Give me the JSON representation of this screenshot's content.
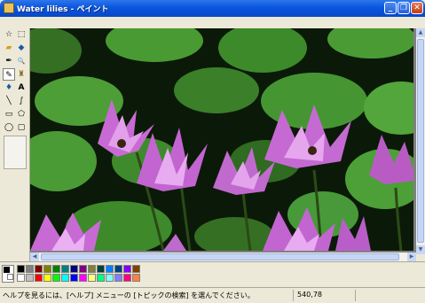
{
  "window": {
    "title": "Water lilies - ペイント",
    "minimize_glyph": "_",
    "maximize_glyph": "❐",
    "close_glyph": "✕"
  },
  "toolbox": {
    "tools": [
      {
        "name": "free-form-select-icon",
        "glyph": "☆"
      },
      {
        "name": "rect-select-icon",
        "glyph": "⬚"
      },
      {
        "name": "eraser-icon",
        "glyph": "▰"
      },
      {
        "name": "fill-bucket-icon",
        "glyph": "◆"
      },
      {
        "name": "color-picker-icon",
        "glyph": "✒"
      },
      {
        "name": "magnifier-icon",
        "glyph": "🔍"
      },
      {
        "name": "pencil-icon",
        "glyph": "✎"
      },
      {
        "name": "brush-icon",
        "glyph": "♜"
      },
      {
        "name": "airbrush-icon",
        "glyph": "♦"
      },
      {
        "name": "text-icon",
        "glyph": "A"
      },
      {
        "name": "line-icon",
        "glyph": "╲"
      },
      {
        "name": "curve-icon",
        "glyph": "∫"
      },
      {
        "name": "rectangle-icon",
        "glyph": "▭"
      },
      {
        "name": "polygon-icon",
        "glyph": "⬠"
      },
      {
        "name": "ellipse-icon",
        "glyph": "◯"
      },
      {
        "name": "rounded-rect-icon",
        "glyph": "▢"
      }
    ]
  },
  "palette": {
    "foreground": "#000000",
    "background": "#ffffff",
    "colors": [
      "#000000",
      "#808080",
      "#800000",
      "#808000",
      "#008000",
      "#008080",
      "#000080",
      "#800080",
      "#808040",
      "#004040",
      "#0080ff",
      "#004080",
      "#8000ff",
      "#804000",
      "#ffffff",
      "#c0c0c0",
      "#ff0000",
      "#ffff00",
      "#00ff00",
      "#00ffff",
      "#0000ff",
      "#ff00ff",
      "#ffff80",
      "#00ff80",
      "#80ffff",
      "#8080ff",
      "#ff0080",
      "#ff8040"
    ]
  },
  "status": {
    "help_text": "ヘルプを見るには、[ヘルプ] メニューの [トピックの検索] を選んでください。",
    "coords": "540,78"
  }
}
